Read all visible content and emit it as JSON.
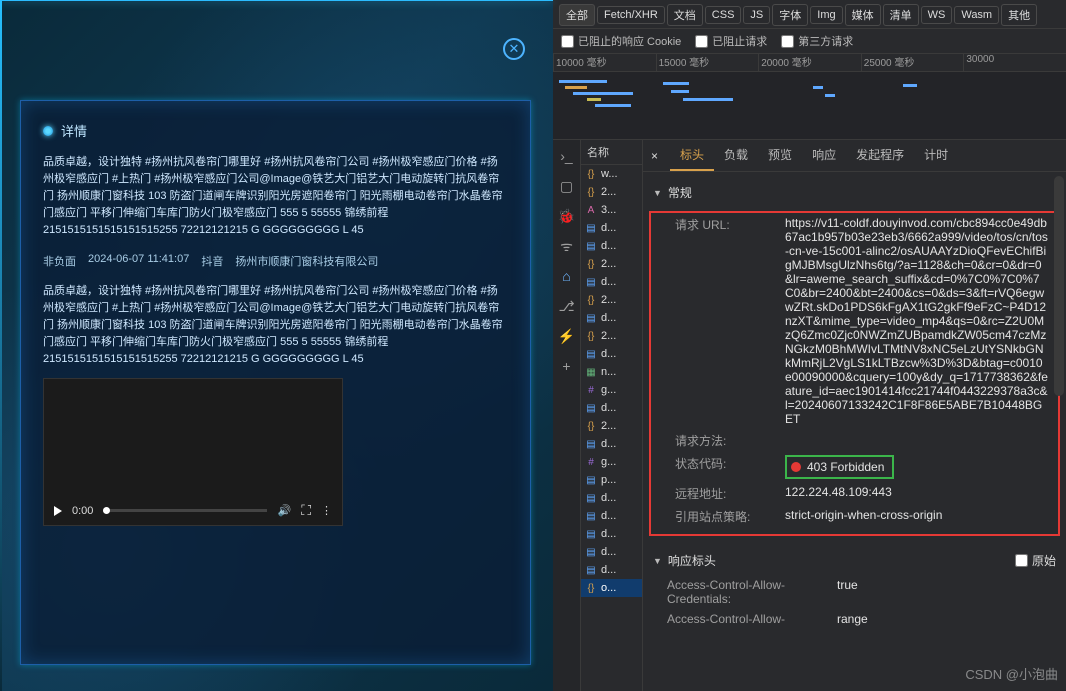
{
  "left": {
    "card_title": "详情",
    "blob1": "品质卓越，设计独特 #扬州抗风卷帘门哪里好 #扬州抗风卷帘门公司 #扬州极窄感应门价格 #扬州极窄感应门 #上热门 #扬州极窄感应门公司@Image@铁艺大门铝艺大门电动旋转门抗风卷帘门 扬州顺康门窗科技 103 防盗门道闸车牌识别阳光房遮阳卷帘门 阳光雨棚电动卷帘门水晶卷帘门感应门 平移门伸缩门车库门防火门极窄感应门 555 5 55555 锦绣前程 2151515151515151515255 72212121215 G GGGGGGGGG L 45",
    "meta_status": "非负面",
    "meta_time": "2024-06-07 11:41:07",
    "meta_source": "抖音",
    "meta_author": "扬州市顺康门窗科技有限公司",
    "blob2": "品质卓越，设计独特 #扬州抗风卷帘门哪里好 #扬州抗风卷帘门公司 #扬州极窄感应门价格 #扬州极窄感应门 #上热门 #扬州极窄感应门公司@Image@铁艺大门铝艺大门电动旋转门抗风卷帘门 扬州顺康门窗科技 103 防盗门道闸车牌识别阳光房遮阳卷帘门 阳光雨棚电动卷帘门水晶卷帘门感应门 平移门伸缩门车库门防火门极窄感应门 555 5 55555 锦绣前程 2151515151515151515255 72212121215 G GGGGGGGGG L 45",
    "video_time": "0:00"
  },
  "devtools": {
    "top_tabs": [
      "全部",
      "Fetch/XHR",
      "文档",
      "CSS",
      "JS",
      "字体",
      "Img",
      "媒体",
      "清单",
      "WS",
      "Wasm",
      "其他"
    ],
    "filter_blocked_cookie": "已阻止的响应 Cookie",
    "filter_blocked_req": "已阻止请求",
    "filter_third": "第三方请求",
    "ruler_ticks": [
      "10000 毫秒",
      "15000 毫秒",
      "20000 毫秒",
      "25000 毫秒",
      "30000"
    ],
    "reqlist_header": "名称",
    "reqs": [
      {
        "ic": "js",
        "t": "w..."
      },
      {
        "ic": "js",
        "t": "2..."
      },
      {
        "ic": "font",
        "t": "3..."
      },
      {
        "ic": "doc",
        "t": "d..."
      },
      {
        "ic": "doc",
        "t": "d..."
      },
      {
        "ic": "js",
        "t": "2..."
      },
      {
        "ic": "doc",
        "t": "d..."
      },
      {
        "ic": "js",
        "t": "2..."
      },
      {
        "ic": "doc",
        "t": "d..."
      },
      {
        "ic": "js",
        "t": "2..."
      },
      {
        "ic": "doc",
        "t": "d..."
      },
      {
        "ic": "img",
        "t": "n..."
      },
      {
        "ic": "css",
        "t": "g..."
      },
      {
        "ic": "doc",
        "t": "d..."
      },
      {
        "ic": "js",
        "t": "2..."
      },
      {
        "ic": "doc",
        "t": "d..."
      },
      {
        "ic": "css",
        "t": "g..."
      },
      {
        "ic": "doc",
        "t": "p..."
      },
      {
        "ic": "doc",
        "t": "d..."
      },
      {
        "ic": "doc",
        "t": "d..."
      },
      {
        "ic": "doc",
        "t": "d..."
      },
      {
        "ic": "doc",
        "t": "d..."
      },
      {
        "ic": "doc",
        "t": "d..."
      },
      {
        "ic": "js",
        "t": "o...",
        "sel": true
      }
    ],
    "detail_tabs": [
      "标头",
      "负载",
      "预览",
      "响应",
      "发起程序",
      "计时"
    ],
    "sec_general": "常规",
    "k_url": "请求 URL:",
    "v_url": "https://v11-coldf.douyinvod.com/cbc894cc0e49db67ac1b957b03e23eb3/6662a999/video/tos/cn/tos-cn-ve-15c001-alinc2/osAUAAYzDioQFevEChifBigMJBMsgUlzNhs6tg/?a=1128&ch=0&cr=0&dr=0&lr=aweme_search_suffix&cd=0%7C0%7C0%7C0&br=2400&bt=2400&cs=0&ds=3&ft=rVQ6egwwZRt.skDo1PDS6kFgAX1tG2gkFf9eFzC~P4D12nzXT&mime_type=video_mp4&qs=0&rc=Z2U0MzQ6Zmc0Zjc0NWZmZUBpamdkZW05cm47czMzNGkzM0BhMWIvLTMtNV8xNC5eLzUtYSNkbGNkMmRjL2VgLS1kLTBzcw%3D%3D&btag=c0010e00090000&cquery=100y&dy_q=1717738362&feature_id=aec1901414fcc21744f0443229378a3c&l=20240607133242C1F8F86E5ABE7B10448BGET",
    "k_method": "请求方法:",
    "k_status": "状态代码:",
    "v_status": "403 Forbidden",
    "k_remote": "远程地址:",
    "v_remote": "122.224.48.109:443",
    "k_refpol": "引用站点策略:",
    "v_refpol": "strict-origin-when-cross-origin",
    "sec_resp": "响应标头",
    "resp_raw": "原始",
    "rh_cred_k": "Access-Control-Allow-Credentials:",
    "rh_cred_v": "true",
    "rh_allow_k": "Access-Control-Allow-",
    "rh_allow_v": "range"
  },
  "watermark": "CSDN @小泡曲"
}
